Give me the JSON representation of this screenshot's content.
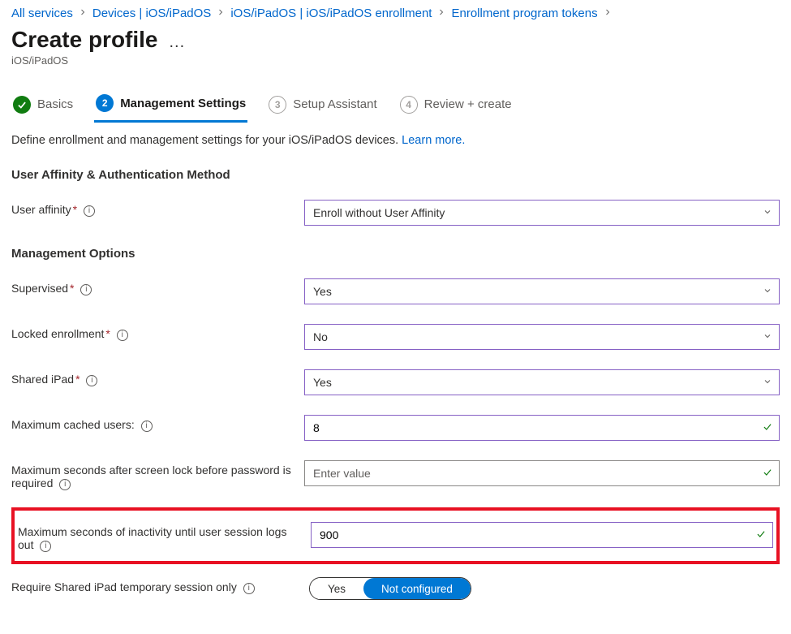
{
  "breadcrumb": {
    "items": [
      {
        "label": "All services"
      },
      {
        "label": "Devices | iOS/iPadOS"
      },
      {
        "label": "iOS/iPadOS | iOS/iPadOS enrollment"
      },
      {
        "label": "Enrollment program tokens"
      }
    ]
  },
  "header": {
    "title": "Create profile",
    "subtitle": "iOS/iPadOS",
    "more": "..."
  },
  "tabs": {
    "basics": "Basics",
    "management": "Management Settings",
    "setup": "Setup Assistant",
    "review": "Review + create",
    "num2": "2",
    "num3": "3",
    "num4": "4"
  },
  "intro": {
    "text": "Define enrollment and management settings for your iOS/iPadOS devices. ",
    "link": "Learn more."
  },
  "sections": {
    "auth": "User Affinity & Authentication Method",
    "mgmt": "Management Options"
  },
  "fields": {
    "user_affinity": {
      "label": "User affinity",
      "value": "Enroll without User Affinity"
    },
    "supervised": {
      "label": "Supervised",
      "value": "Yes"
    },
    "locked": {
      "label": "Locked enrollment",
      "value": "No"
    },
    "shared": {
      "label": "Shared iPad",
      "value": "Yes"
    },
    "max_cached": {
      "label": "Maximum cached users:",
      "value": "8"
    },
    "max_lock": {
      "label": "Maximum seconds after screen lock before password is required",
      "placeholder": "Enter value",
      "value": ""
    },
    "max_inactivity": {
      "label": "Maximum seconds of inactivity until user session logs out",
      "value": "900"
    },
    "temp_session": {
      "label": "Require Shared iPad temporary session only",
      "opt_yes": "Yes",
      "opt_no": "Not configured"
    }
  },
  "glyphs": {
    "info": "i",
    "check": "✓"
  }
}
